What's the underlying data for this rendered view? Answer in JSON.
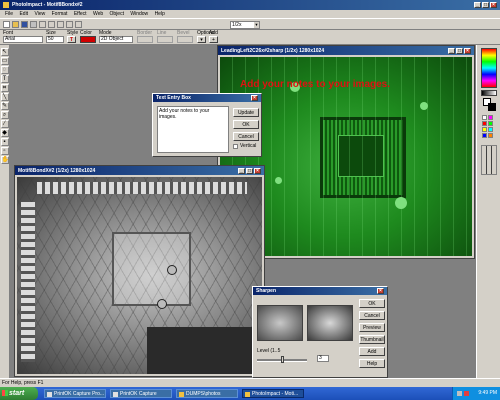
{
  "app": {
    "title": "PhotoImpact - Motif8Bondx#2",
    "menu": [
      "File",
      "Edit",
      "View",
      "Format",
      "Effect",
      "Web",
      "Object",
      "Window",
      "Help"
    ],
    "zoom": "1/2x"
  },
  "attrbar": {
    "font_label": "Font",
    "font_value": "Arial",
    "size_label": "Size",
    "size_value": "50",
    "style_label": "Style",
    "style_value": "T",
    "color_label": "Color",
    "color_value": "#d00000",
    "mode_label": "Mode",
    "mode_value": "2D Object",
    "border_label": "Border",
    "line_label": "Line",
    "bevel_label": "Bevel",
    "options_label": "Options",
    "add_label": "Add"
  },
  "green_window": {
    "title": "LeadingLeft2C26x#2sharp (1/2x) 1280x1024",
    "overlay_text": "Add your notes to your images."
  },
  "xray_window": {
    "title": "Motif8BondX#2 (1/2x) 1280x1024"
  },
  "text_dialog": {
    "title": "Text Entry Box",
    "text_value": "Add your notes to your images.",
    "update_label": "Update",
    "ok_label": "OK",
    "cancel_label": "Cancel",
    "vertical_label": "Vertical"
  },
  "sharpen_dialog": {
    "title": "Sharpen",
    "ok_label": "OK",
    "cancel_label": "Cancel",
    "preview_label": "Preview",
    "thumbnail_label": "Thumbnail",
    "add_label": "Add",
    "help_label": "Help",
    "level_label": "Level (1..5",
    "level_value": "3"
  },
  "statusbar": {
    "text": "For Help, press F1"
  },
  "taskbar": {
    "start_label": "start",
    "items": [
      "PrintOK Capture Pro...",
      "PrintOK Capture",
      "DUMPS\\photos",
      "PhotoImpact - Moti..."
    ],
    "clock": "9:49 PM"
  },
  "colors": {
    "accent": "#0a246a",
    "green_board": "#1e8a1e",
    "overlay_red": "#e01010"
  }
}
